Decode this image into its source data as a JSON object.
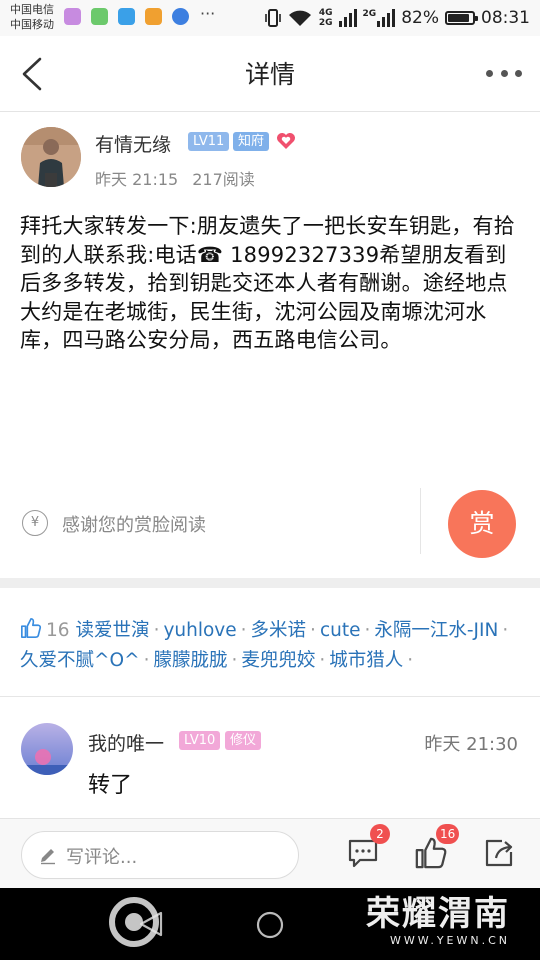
{
  "status_bar": {
    "carrier_1": "中国电信",
    "carrier_2": "中国移动",
    "net_4g": "4G",
    "net_2g_a": "2G",
    "net_2g_b": "2G",
    "battery": "82%",
    "battery_level": 0.82,
    "time": "08:31"
  },
  "header": {
    "title": "详情"
  },
  "author": {
    "name": "有情无缘",
    "level_badge": "LV11",
    "role_badge": "知府",
    "time": "昨天 21:15",
    "reads": "217阅读"
  },
  "post": {
    "text": "拜托大家转发一下:朋友遗失了一把长安车钥匙，有拾到的人联系我:电话☎ 18992327339希望朋友看到后多多转发，拾到钥匙交还本人者有酬谢。途经地点 大约是在老城街，民生街，沈河公园及南塬沈河水库，四马路公安分局，西五路电信公司。"
  },
  "reward": {
    "currency_symbol": "¥",
    "prompt": "感谢您的赏脸阅读",
    "button": "赏"
  },
  "likes": {
    "count": "16",
    "users": [
      "读爱世演",
      "yuhlove",
      "多米诺",
      "cute",
      "永隔一江水-JIN",
      "久爱不腻^O^",
      "朦朦胧胧",
      "麦兜兜姣",
      "城市猎人"
    ]
  },
  "comment": {
    "name": "我的唯一",
    "level_badge": "LV10",
    "role_badge": "修仪",
    "time": "昨天 21:30",
    "text": "转了"
  },
  "bottom_bar": {
    "input_placeholder": "写评论...",
    "comment_count": "2",
    "like_count": "16"
  },
  "watermark": {
    "name": "荣耀渭南",
    "url": "WWW.YEWN.CN"
  },
  "colors": {
    "link": "#2a73b8",
    "reward": "#f8755a",
    "badge_level": "#8fb8ec",
    "badge_role": "#7fb0ea",
    "badge_comment": "#f2a8d8",
    "notification": "#f05050"
  },
  "icons": [
    "back-icon",
    "more-icon",
    "heart-icon",
    "thumbs-up-icon",
    "pencil-icon",
    "comment-icon",
    "share-icon",
    "nav-back-icon",
    "nav-home-icon"
  ]
}
